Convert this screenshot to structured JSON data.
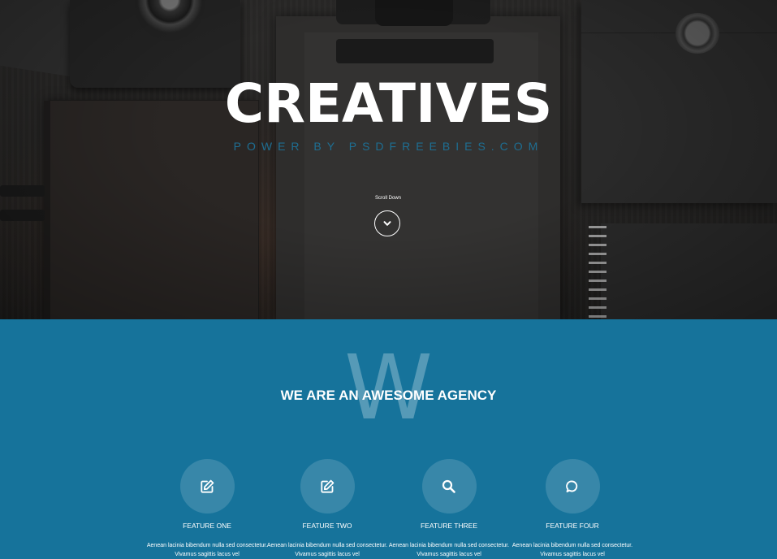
{
  "hero": {
    "title": "CREATIVES",
    "subtitle": "POWER BY PSDFREEBIES.COM",
    "scroll_label": "Scroll Down",
    "scroll_icon": "chevron-down-icon"
  },
  "intro": {
    "watermark_letter": "W",
    "heading": "WE ARE AN AWESOME AGENCY"
  },
  "features": [
    {
      "icon": "edit-icon",
      "title": "FEATURE ONE",
      "description": "Aenean lacinia bibendum nulla sed consectetur. Vivamus sagittis lacus vel"
    },
    {
      "icon": "edit-icon",
      "title": "FEATURE TWO",
      "description": "Aenean lacinia bibendum nulla sed consectetur. Vivamus sagittis lacus vel"
    },
    {
      "icon": "search-icon",
      "title": "FEATURE THREE",
      "description": "Aenean lacinia bibendum nulla sed consectetur. Vivamus sagittis lacus vel"
    },
    {
      "icon": "chat-bubble-icon",
      "title": "FEATURE FOUR",
      "description": "Aenean lacinia bibendum nulla sed consectetur. Vivamus sagittis lacus vel"
    }
  ],
  "colors": {
    "brand_blue": "#16739b",
    "subtitle_blue": "#1e6e92",
    "white": "#ffffff"
  }
}
